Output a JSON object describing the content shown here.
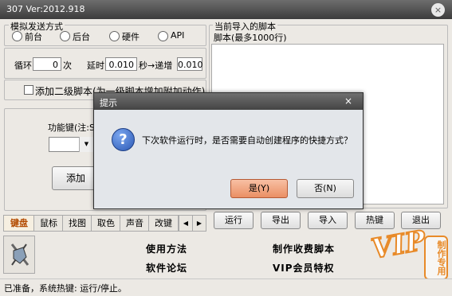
{
  "window": {
    "title": "307  Ver:2012.918",
    "close": "×"
  },
  "send_mode": {
    "legend": "模拟发送方式",
    "options": [
      "前台",
      "后台",
      "硬件",
      "API"
    ]
  },
  "loop": {
    "label": "循环",
    "value": "0",
    "unit": "次"
  },
  "delay": {
    "label": "延时",
    "value": "0.010",
    "unit": "秒→递增",
    "inc_value": "0.010"
  },
  "secondary": {
    "label": "添加二级脚本(为一级脚本增加附加动作)"
  },
  "function_key": {
    "label": "功能键(注:Sh",
    "dropdown_arrow": "▼"
  },
  "add_button": {
    "label": "添加"
  },
  "tabs": [
    "键盘",
    "鼠标",
    "找图",
    "取色",
    "声音",
    "改键"
  ],
  "tab_arrows": [
    "◀",
    "▶"
  ],
  "script_panel": {
    "legend": "当前导入的脚本",
    "subtitle": "脚本(最多1000行)"
  },
  "actions": [
    "运行",
    "导出",
    "导入",
    "热键",
    "退出"
  ],
  "links": {
    "usage": "使用方法",
    "forum": "软件论坛",
    "paid": "制作收费脚本",
    "vip": "VIP会员特权"
  },
  "watermark": {
    "vip": "VIP",
    "stamp": "制作专用"
  },
  "status": "已准备，系统热键: 运行/停止。",
  "dialog": {
    "title": "提示",
    "close": "×",
    "message": "下次软件运行时，是否需要自动创建程序的快捷方式？",
    "icon": "?",
    "yes": "是(Y)",
    "no": "否(N)"
  },
  "colors": {
    "tab_active": "#b34a00",
    "yes_button": "#f19a70",
    "question_icon": "#2c59b5"
  }
}
